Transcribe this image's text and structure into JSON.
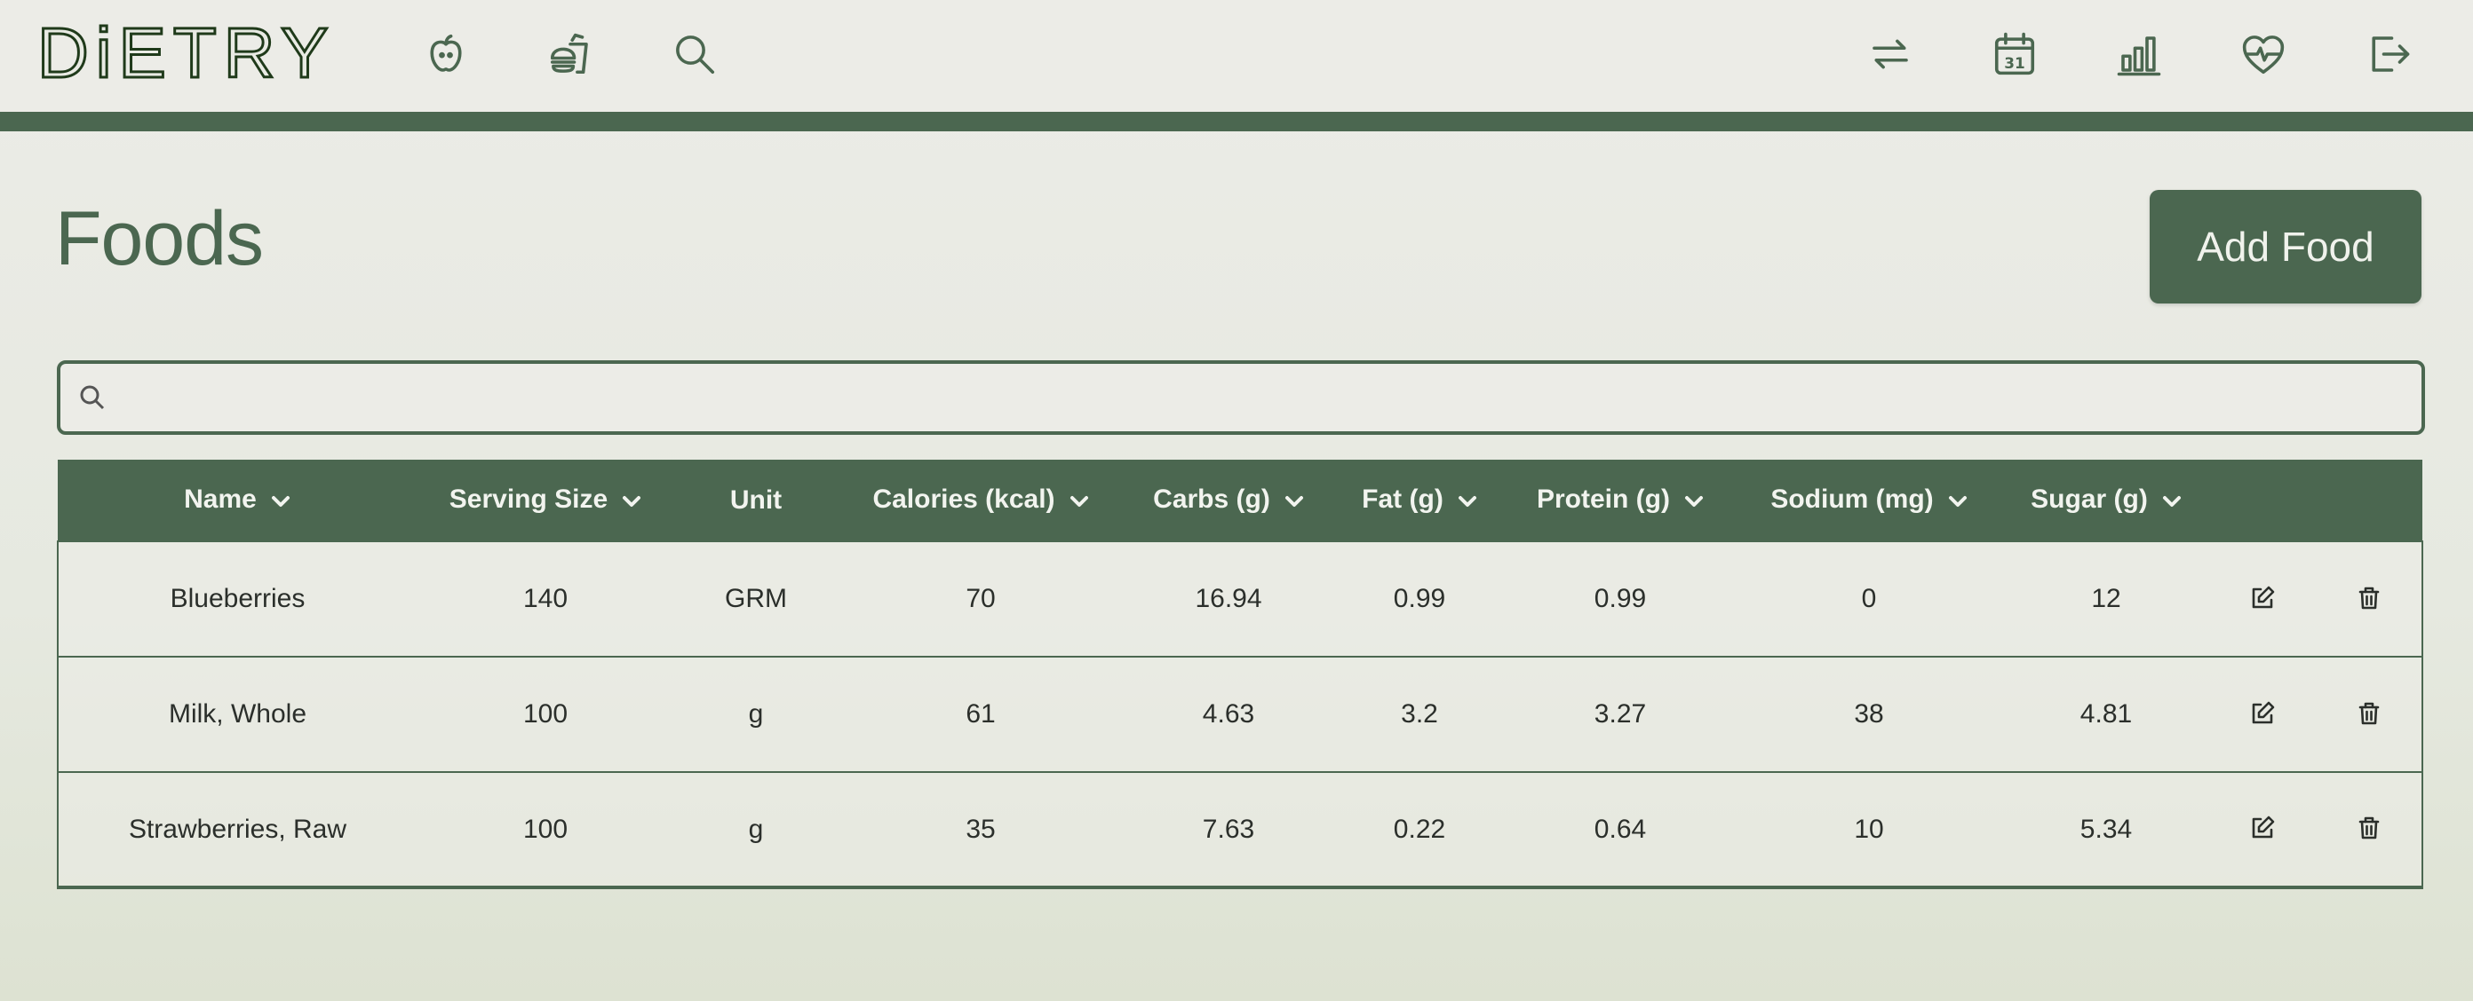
{
  "app": {
    "logo_text": "DiETRY"
  },
  "nav": {
    "left_icons": [
      "apple-icon",
      "fast-food-icon",
      "search-icon"
    ],
    "right_icons": [
      "swap-icon",
      "calendar-icon",
      "bar-chart-icon",
      "heart-pulse-icon",
      "logout-icon"
    ],
    "calendar_day": "31"
  },
  "page": {
    "title": "Foods",
    "add_button_label": "Add Food"
  },
  "search": {
    "placeholder": "",
    "value": ""
  },
  "table": {
    "columns": [
      {
        "label": "Name",
        "sortable": true
      },
      {
        "label": "Serving Size",
        "sortable": true
      },
      {
        "label": "Unit",
        "sortable": false
      },
      {
        "label": "Calories (kcal)",
        "sortable": true
      },
      {
        "label": "Carbs (g)",
        "sortable": true
      },
      {
        "label": "Fat (g)",
        "sortable": true
      },
      {
        "label": "Protein (g)",
        "sortable": true
      },
      {
        "label": "Sodium (mg)",
        "sortable": true
      },
      {
        "label": "Sugar (g)",
        "sortable": true
      }
    ],
    "rows": [
      {
        "name": "Blueberries",
        "serving_size": "140",
        "unit": "GRM",
        "calories": "70",
        "carbs": "16.94",
        "fat": "0.99",
        "protein": "0.99",
        "sodium": "0",
        "sugar": "12"
      },
      {
        "name": "Milk, Whole",
        "serving_size": "100",
        "unit": "g",
        "calories": "61",
        "carbs": "4.63",
        "fat": "3.2",
        "protein": "3.27",
        "sodium": "38",
        "sugar": "4.81"
      },
      {
        "name": "Strawberries, Raw",
        "serving_size": "100",
        "unit": "g",
        "calories": "35",
        "carbs": "7.63",
        "fat": "0.22",
        "protein": "0.64",
        "sodium": "10",
        "sugar": "5.34"
      }
    ]
  },
  "colors": {
    "primary": "#4b6750",
    "background": "#ecece7",
    "text": "#2b2f2b"
  }
}
